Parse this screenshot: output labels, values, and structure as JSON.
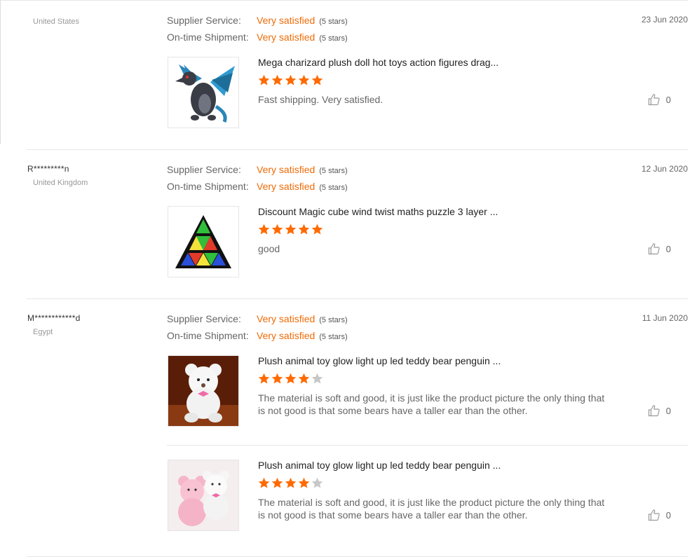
{
  "labels": {
    "supplier_service": "Supplier Service:",
    "ontime_shipment": "On-time Shipment:",
    "very_satisfied": "Very satisfied",
    "five_stars": "(5 stars)"
  },
  "colors": {
    "accent": "#f06b07",
    "star_filled": "#ff6a00",
    "star_empty": "#c7c7c7"
  },
  "feedbacks": [
    {
      "buyer": "",
      "country": "United States",
      "date": "23 Jun 2020",
      "items": [
        {
          "image_icon": "charizard-plush-image",
          "title": "Mega charizard plush doll hot toys action figures drag...",
          "rating": 5,
          "comment": "Fast shipping. Very satisfied.",
          "useful_count": "0"
        }
      ]
    },
    {
      "buyer": "R*********n",
      "country": "United Kingdom",
      "date": "12 Jun 2020",
      "items": [
        {
          "image_icon": "pyramid-cube-image",
          "title": "Discount Magic cube wind twist maths puzzle 3 layer ...",
          "rating": 5,
          "comment": "good",
          "useful_count": "0"
        }
      ]
    },
    {
      "buyer": "M************d",
      "country": "Egypt",
      "date": "11 Jun 2020",
      "items": [
        {
          "image_icon": "white-teddy-bear-image",
          "title": "Plush animal toy glow light up led teddy bear penguin ...",
          "rating": 4,
          "comment": "The material is soft and good, it is just like the product picture the only thing that is not good is that some bears have a taller ear than the other.",
          "useful_count": "0"
        },
        {
          "image_icon": "pink-teddy-bear-image",
          "title": "Plush animal toy glow light up led teddy bear penguin ...",
          "rating": 4,
          "comment": "The material is soft and good, it is just like the product picture the only thing that is not good is that some bears have a taller ear than the other.",
          "useful_count": "0"
        }
      ]
    }
  ]
}
